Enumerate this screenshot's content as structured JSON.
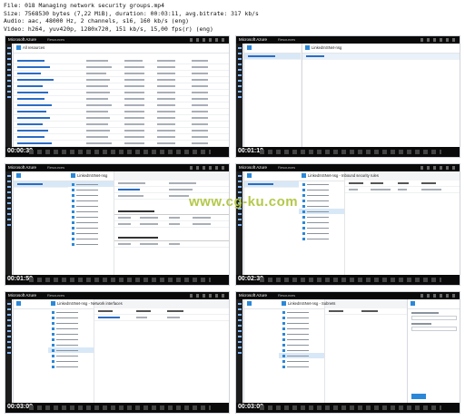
{
  "file_info": {
    "line1": "File: 018 Managing network security groups.mp4",
    "line2": "Size: 7568530 bytes (7,22 MiB), duration: 00:03:11, avg.bitrate: 317 kb/s",
    "line3": "Audio: aac, 48000 Hz, 2 channels, s16, 160 kb/s (eng)",
    "line4": "Video: h264, yuv420p, 1280x720, 151 kb/s, 15,00 fps(r) (eng)"
  },
  "app": {
    "brand": "Microsoft Azure",
    "crumb": "Resources"
  },
  "thumbnails": [
    {
      "timestamp": "00:00:39",
      "blade_title": "All resources"
    },
    {
      "timestamp": "00:01:19",
      "blade_title": "LinkedInSNet-nsg"
    },
    {
      "timestamp": "00:01:59",
      "blade_title": "LinkedInSNet-nsg"
    },
    {
      "timestamp": "00:02:39",
      "blade_title": "LinkedInSNet-nsg - Inbound security rules"
    },
    {
      "timestamp": "00:03:09",
      "blade_title": "LinkedInSNet-nsg - Network interfaces"
    },
    {
      "timestamp": "00:03:09",
      "blade_title": "LinkedInSNet-nsg - Subnets"
    }
  ],
  "watermark": "www.cg-ku.com",
  "colors": {
    "azure_blue": "#2b88d8",
    "top_bar": "#0a0a0a",
    "selected_menu": "#d8e8f7",
    "watermark": "#b5c84a"
  }
}
